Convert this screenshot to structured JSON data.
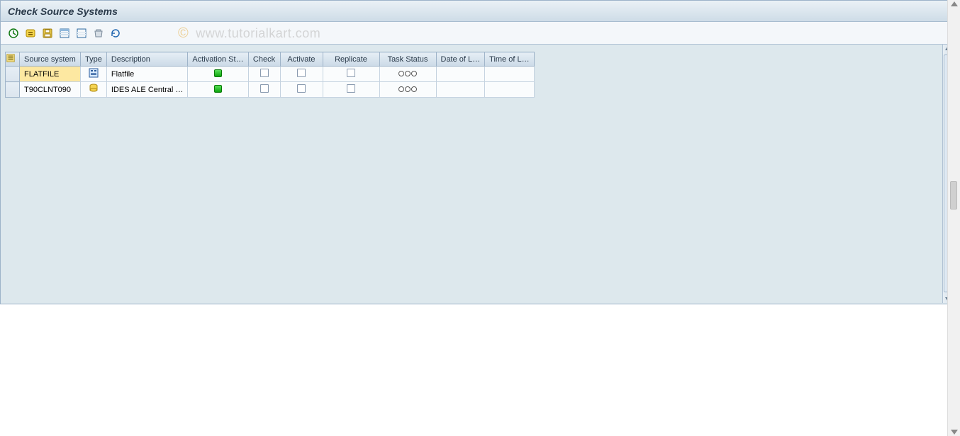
{
  "header": {
    "title": "Check Source Systems"
  },
  "watermark": {
    "copyright": "©",
    "text": "www.tutorialkart.com"
  },
  "toolbar": {
    "execute": "Execute",
    "variant": "Variant",
    "save": "Save",
    "select_all": "Select All",
    "deselect": "Deselect All",
    "refresh": "Refresh",
    "log": "Log"
  },
  "grid": {
    "headers": {
      "select": "",
      "source_system": "Source system",
      "type": "Type",
      "description": "Description",
      "activation": "Activation St…",
      "check": "Check",
      "activate": "Activate",
      "replicate": "Replicate",
      "task_status": "Task Status",
      "date": "Date of L…",
      "time": "Time of L…"
    },
    "rows": [
      {
        "source_system": "FLATFILE",
        "type_icon": "flatfile",
        "description": "Flatfile",
        "activation": "green",
        "check": false,
        "activate": false,
        "replicate": false,
        "task_status": "ooo",
        "date": "",
        "time": "",
        "selected": true
      },
      {
        "source_system": "T90CLNT090",
        "type_icon": "sapclient",
        "description": "IDES ALE Central …",
        "activation": "green",
        "check": false,
        "activate": false,
        "replicate": false,
        "task_status": "ooo",
        "date": "",
        "time": "",
        "selected": false
      }
    ]
  }
}
